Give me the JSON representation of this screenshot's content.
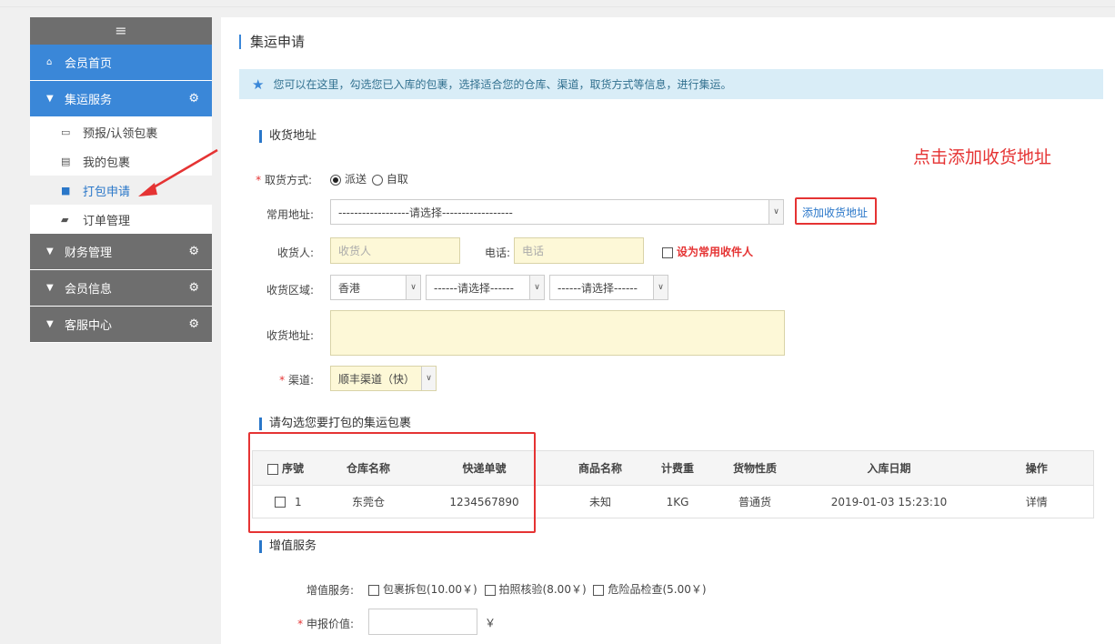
{
  "sidebar": {
    "menu_icon": "≡",
    "home": "会员首页",
    "sections": [
      {
        "label": "集运服务"
      },
      {
        "label": "财务管理"
      },
      {
        "label": "会员信息"
      },
      {
        "label": "客服中心"
      }
    ],
    "sub_items": [
      {
        "label": "预报/认领包裹",
        "icon": "inbox-icon"
      },
      {
        "label": "我的包裹",
        "icon": "list-icon"
      },
      {
        "label": "打包申请",
        "icon": "truck-icon"
      },
      {
        "label": "订单管理",
        "icon": "book-icon"
      }
    ]
  },
  "page": {
    "title": "集运申请",
    "tip": "您可以在这里，勾选您已入库的包裹，选择适合您的仓库、渠道，取货方式等信息，进行集运。"
  },
  "address_section": {
    "title": "收货地址",
    "pickup_label": "取货方式:",
    "pickup_options": [
      "派送",
      "自取"
    ],
    "common_addr_label": "常用地址:",
    "common_addr_value": "------------------请选择------------------",
    "add_address_link": "添加收货地址",
    "receiver_label": "收货人:",
    "receiver_placeholder": "收货人",
    "phone_label": "电话:",
    "phone_placeholder": "电话",
    "set_common_label": "设为常用收件人",
    "region_label": "收货区域:",
    "region_values": [
      "香港",
      "------请选择------",
      "------请选择------"
    ],
    "address_label": "收货地址:",
    "channel_label": "渠道:",
    "channel_value": "顺丰渠道（快）"
  },
  "packages_section": {
    "title": "请勾选您要打包的集运包裹",
    "columns": [
      "序號",
      "仓库名称",
      "快递单號",
      "商品名称",
      "计费重",
      "货物性质",
      "入库日期",
      "操作"
    ],
    "rows": [
      [
        "1",
        "东莞仓",
        "1234567890",
        "未知",
        "1KG",
        "普通货",
        "2019-01-03 15:23:10",
        "详情"
      ]
    ]
  },
  "value_section": {
    "title": "增值服务",
    "services_label": "增值服务:",
    "services": [
      "包裹拆包(10.00￥)",
      "拍照核验(8.00￥)",
      "危险品检查(5.00￥)"
    ],
    "declared_label": "申报价值:",
    "currency": "￥"
  },
  "annotation": "点击添加收货地址"
}
